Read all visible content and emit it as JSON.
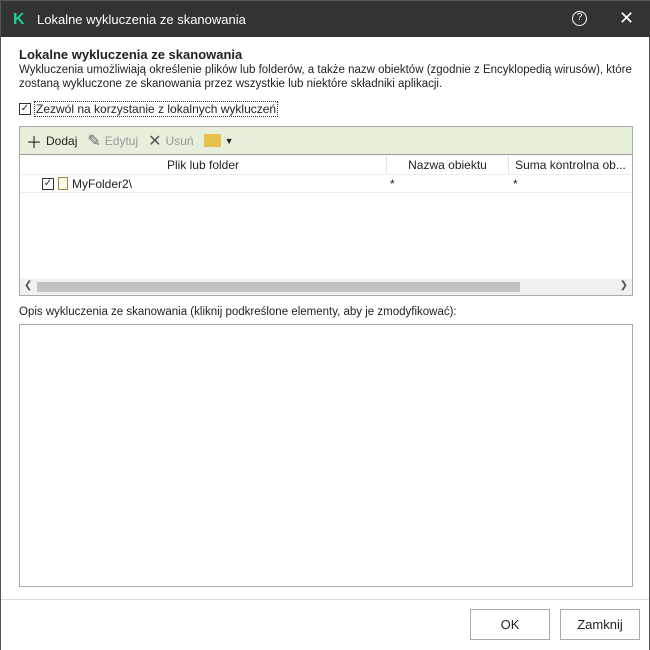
{
  "window": {
    "title": "Lokalne wykluczenia ze skanowania",
    "logo": "K"
  },
  "heading": "Lokalne wykluczenia ze skanowania",
  "description": "Wykluczenia umożliwiają określenie plików lub folderów, a także nazw obiektów (zgodnie z Encyklopedią wirusów), które zostaną wykluczone ze skanowania przez wszystkie lub niektóre składniki aplikacji.",
  "allow_checkbox": {
    "label": "Zezwól na korzystanie z lokalnych wykluczeń",
    "checked": true
  },
  "toolbar": {
    "add": "Dodaj",
    "edit": "Edytuj",
    "delete": "Usuń"
  },
  "table": {
    "columns": [
      "Plik lub folder",
      "Nazwa obiektu",
      "Suma kontrolna ob..."
    ],
    "rows": [
      {
        "path": "MyFolder2\\",
        "object": "*",
        "checksum": "*",
        "checked": true
      }
    ]
  },
  "description_label": "Opis wykluczenia ze skanowania (kliknij podkreślone elementy, aby je zmodyfikować):",
  "buttons": {
    "ok": "OK",
    "close": "Zamknij"
  }
}
